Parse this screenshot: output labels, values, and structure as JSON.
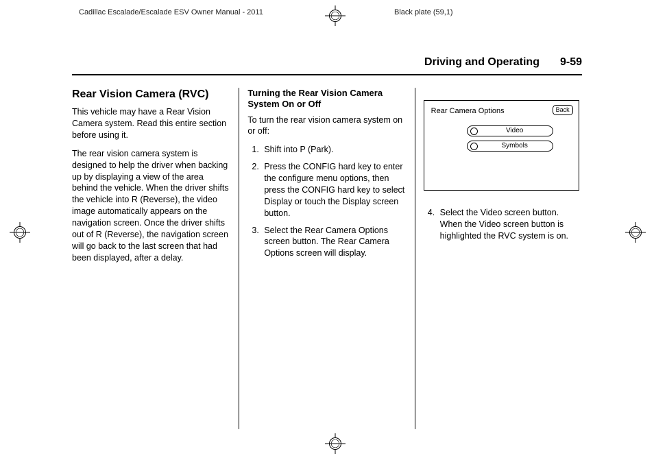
{
  "meta": {
    "docTitle": "Cadillac Escalade/Escalade ESV Owner Manual - 2011",
    "plate": "Black plate (59,1)"
  },
  "header": {
    "section": "Driving and Operating",
    "pageNumber": "9-59"
  },
  "col1": {
    "heading": "Rear Vision Camera (RVC)",
    "p1": "This vehicle may have a Rear Vision Camera system. Read this entire section before using it.",
    "p2": "The rear vision camera system is designed to help the driver when backing up by displaying a view of the area behind the vehicle. When the driver shifts the vehicle into R (Reverse), the video image automatically appears on the navigation screen. Once the driver shifts out of R  (Reverse), the navigation screen will go back to the last screen that had been displayed, after a delay."
  },
  "col2": {
    "heading": "Turning the Rear Vision Camera System On or Off",
    "intro": "To turn the rear vision camera system on or off:",
    "steps": {
      "s1": "Shift into P (Park).",
      "s2": "Press the CONFIG hard key to enter the configure menu options, then press the CONFIG hard key to select Display or touch the Display screen button.",
      "s3": "Select the Rear Camera Options screen button. The Rear Camera Options screen will display."
    }
  },
  "col3": {
    "screen": {
      "title": "Rear Camera Options",
      "back": "Back",
      "btnVideo": "Video",
      "btnSymbols": "Symbols"
    },
    "step4": "Select the Video screen button. When the Video screen button is highlighted the RVC system is on."
  }
}
